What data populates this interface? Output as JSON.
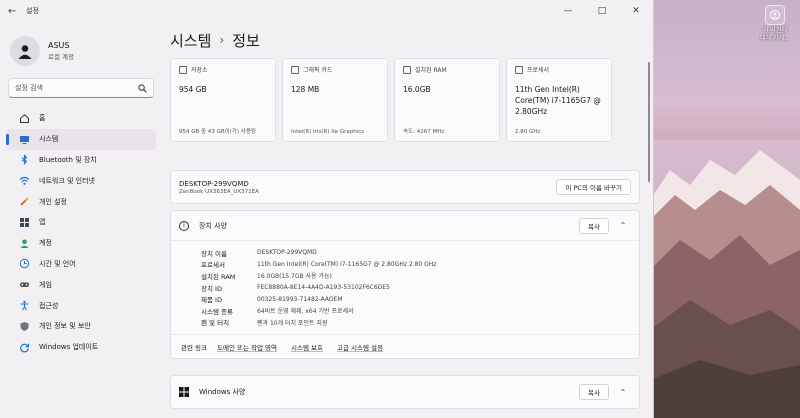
{
  "window": {
    "app_title": "설정",
    "controls": {
      "minimize": "—",
      "maximize": "□",
      "close": "✕"
    }
  },
  "profile": {
    "name": "ASUS",
    "type": "로컬 계정"
  },
  "search": {
    "placeholder": "설정 검색"
  },
  "sidebar": {
    "items": [
      {
        "label": "홈",
        "icon": "home-icon",
        "active": false
      },
      {
        "label": "시스템",
        "icon": "monitor-icon",
        "active": true
      },
      {
        "label": "Bluetooth 및 장치",
        "icon": "bluetooth-icon",
        "active": false
      },
      {
        "label": "네트워크 및 인터넷",
        "icon": "wifi-icon",
        "active": false
      },
      {
        "label": "개인 설정",
        "icon": "brush-icon",
        "active": false
      },
      {
        "label": "앱",
        "icon": "apps-icon",
        "active": false
      },
      {
        "label": "계정",
        "icon": "person-icon",
        "active": false
      },
      {
        "label": "시간 및 언어",
        "icon": "globe-clock-icon",
        "active": false
      },
      {
        "label": "게임",
        "icon": "gamepad-icon",
        "active": false
      },
      {
        "label": "접근성",
        "icon": "accessibility-icon",
        "active": false
      },
      {
        "label": "개인 정보 및 보안",
        "icon": "shield-icon",
        "active": false
      },
      {
        "label": "Windows 업데이트",
        "icon": "update-icon",
        "active": false
      }
    ]
  },
  "breadcrumb": {
    "parent": "시스템",
    "separator": "›",
    "current": "정보"
  },
  "spec_cards": [
    {
      "label": "저장소",
      "value": "954 GB",
      "foot": "954 GB 중 43 GB이(가) 사용됨",
      "icon": "storage-icon"
    },
    {
      "label": "그래픽 카드",
      "value": "128 MB",
      "foot": "Intel(R) Iris(R) Xe Graphics",
      "icon": "gpu-icon"
    },
    {
      "label": "설치된 RAM",
      "value": "16.0GB",
      "foot": "속도: 4267 MHz",
      "icon": "ram-icon"
    },
    {
      "label": "프로세서",
      "value": "11th Gen Intel(R) Core(TM) i7-1165G7 @ 2.80GHz",
      "foot": "2.80 GHz",
      "icon": "cpu-icon"
    }
  ],
  "device": {
    "name": "DESKTOP-299VQMD",
    "model": "ZenBook UX363EA_UX371EA",
    "rename_button": "이 PC의 이름 바꾸기"
  },
  "device_specs": {
    "title": "장치 사양",
    "copy_button": "복사",
    "rows": [
      {
        "key": "장치 이름",
        "value": "DESKTOP-299VQMD"
      },
      {
        "key": "프로세서",
        "value": "11th Gen Intel(R) Core(TM) i7-1165G7 @ 2.80GHz   2.80 GHz"
      },
      {
        "key": "설치된 RAM",
        "value": "16.0GB(15.7GB 사용 가능)"
      },
      {
        "key": "장치 ID",
        "value": "FEC8880A-8E14-4A4D-A193-53102F6C6DE5"
      },
      {
        "key": "제품 ID",
        "value": "00325-81993-71482-AAOEM"
      },
      {
        "key": "시스템 종류",
        "value": "64비트 운영 체제, x64 기반 프로세서"
      },
      {
        "key": "펜 및 터치",
        "value": "펜과 10개 터치 포인트 지원"
      }
    ],
    "related_title": "관련 링크",
    "related_links": [
      "도메인 또는 작업 영역",
      "시스템 보호",
      "고급 시스템 설정"
    ]
  },
  "windows_specs": {
    "title": "Windows 사양",
    "copy_button": "복사"
  },
  "desktop": {
    "icon_label_line1": "이 사진에",
    "icon_label_line2": "대해 자세..."
  },
  "colors": {
    "accent": "#2b6fce",
    "window_bg": "#f3f0f4",
    "card_bg": "#fbfafc"
  }
}
